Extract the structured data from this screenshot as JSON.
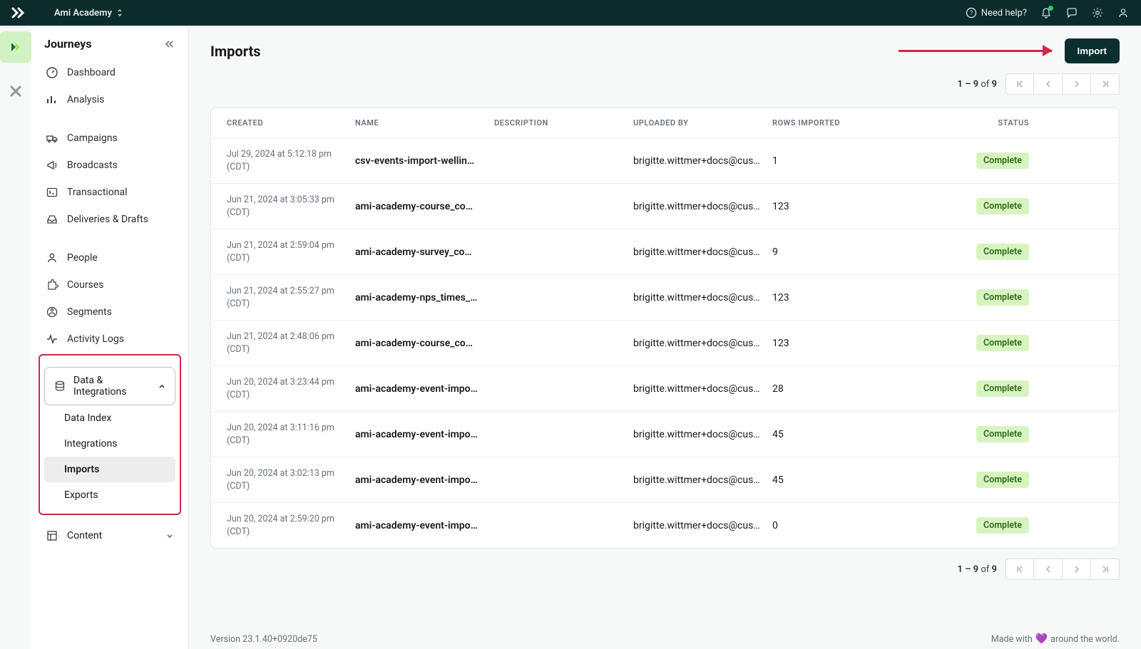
{
  "topbar": {
    "workspace": "Ami Academy",
    "need_help": "Need help?"
  },
  "sidebar": {
    "title": "Journeys",
    "items": [
      {
        "icon": "dashboard",
        "label": "Dashboard"
      },
      {
        "icon": "analysis",
        "label": "Analysis"
      }
    ],
    "group2": [
      {
        "icon": "campaigns",
        "label": "Campaigns"
      },
      {
        "icon": "broadcasts",
        "label": "Broadcasts"
      },
      {
        "icon": "transactional",
        "label": "Transactional"
      },
      {
        "icon": "deliveries",
        "label": "Deliveries & Drafts"
      }
    ],
    "group3": [
      {
        "icon": "people",
        "label": "People"
      },
      {
        "icon": "courses",
        "label": "Courses"
      },
      {
        "icon": "segments",
        "label": "Segments"
      },
      {
        "icon": "activity",
        "label": "Activity Logs"
      }
    ],
    "data_integrations": {
      "label": "Data & Integrations",
      "children": [
        {
          "label": "Data Index"
        },
        {
          "label": "Integrations"
        },
        {
          "label": "Imports",
          "active": true
        },
        {
          "label": "Exports"
        }
      ]
    },
    "content": {
      "label": "Content"
    }
  },
  "page": {
    "title": "Imports",
    "import_button": "Import",
    "pagination": {
      "range": "1 – 9",
      "of": "of",
      "total": "9"
    },
    "columns": {
      "created": "CREATED",
      "name": "NAME",
      "description": "DESCRIPTION",
      "uploaded_by": "UPLOADED BY",
      "rows_imported": "ROWS IMPORTED",
      "status": "STATUS"
    },
    "rows": [
      {
        "created": "Jul 29, 2024 at 5:12:18 pm (CDT)",
        "name": "csv-events-import-wellin…",
        "description": "",
        "uploaded_by": "brigitte.wittmer+docs@cus…",
        "rows_imported": "1",
        "status": "Complete"
      },
      {
        "created": "Jun 21, 2024 at 3:05:33 pm (CDT)",
        "name": "ami-academy-course_co…",
        "description": "",
        "uploaded_by": "brigitte.wittmer+docs@cus…",
        "rows_imported": "123",
        "status": "Complete"
      },
      {
        "created": "Jun 21, 2024 at 2:59:04 pm (CDT)",
        "name": "ami-academy-survey_co…",
        "description": "",
        "uploaded_by": "brigitte.wittmer+docs@cus…",
        "rows_imported": "9",
        "status": "Complete"
      },
      {
        "created": "Jun 21, 2024 at 2:55:27 pm (CDT)",
        "name": "ami-academy-nps_times_…",
        "description": "",
        "uploaded_by": "brigitte.wittmer+docs@cus…",
        "rows_imported": "123",
        "status": "Complete"
      },
      {
        "created": "Jun 21, 2024 at 2:48:06 pm (CDT)",
        "name": "ami-academy-course_co…",
        "description": "",
        "uploaded_by": "brigitte.wittmer+docs@cus…",
        "rows_imported": "123",
        "status": "Complete"
      },
      {
        "created": "Jun 20, 2024 at 3:23:44 pm (CDT)",
        "name": "ami-academy-event-impo…",
        "description": "",
        "uploaded_by": "brigitte.wittmer+docs@cus…",
        "rows_imported": "28",
        "status": "Complete"
      },
      {
        "created": "Jun 20, 2024 at 3:11:16 pm (CDT)",
        "name": "ami-academy-event-impo…",
        "description": "",
        "uploaded_by": "brigitte.wittmer+docs@cus…",
        "rows_imported": "45",
        "status": "Complete"
      },
      {
        "created": "Jun 20, 2024 at 3:02:13 pm (CDT)",
        "name": "ami-academy-event-impo…",
        "description": "",
        "uploaded_by": "brigitte.wittmer+docs@cus…",
        "rows_imported": "45",
        "status": "Complete"
      },
      {
        "created": "Jun 20, 2024 at 2:59:20 pm (CDT)",
        "name": "ami-academy-event-impo…",
        "description": "",
        "uploaded_by": "brigitte.wittmer+docs@cus…",
        "rows_imported": "0",
        "status": "Complete"
      }
    ]
  },
  "footer": {
    "version": "Version 23.1.40+0920de75",
    "made1": "Made with",
    "made2": "around the world."
  }
}
